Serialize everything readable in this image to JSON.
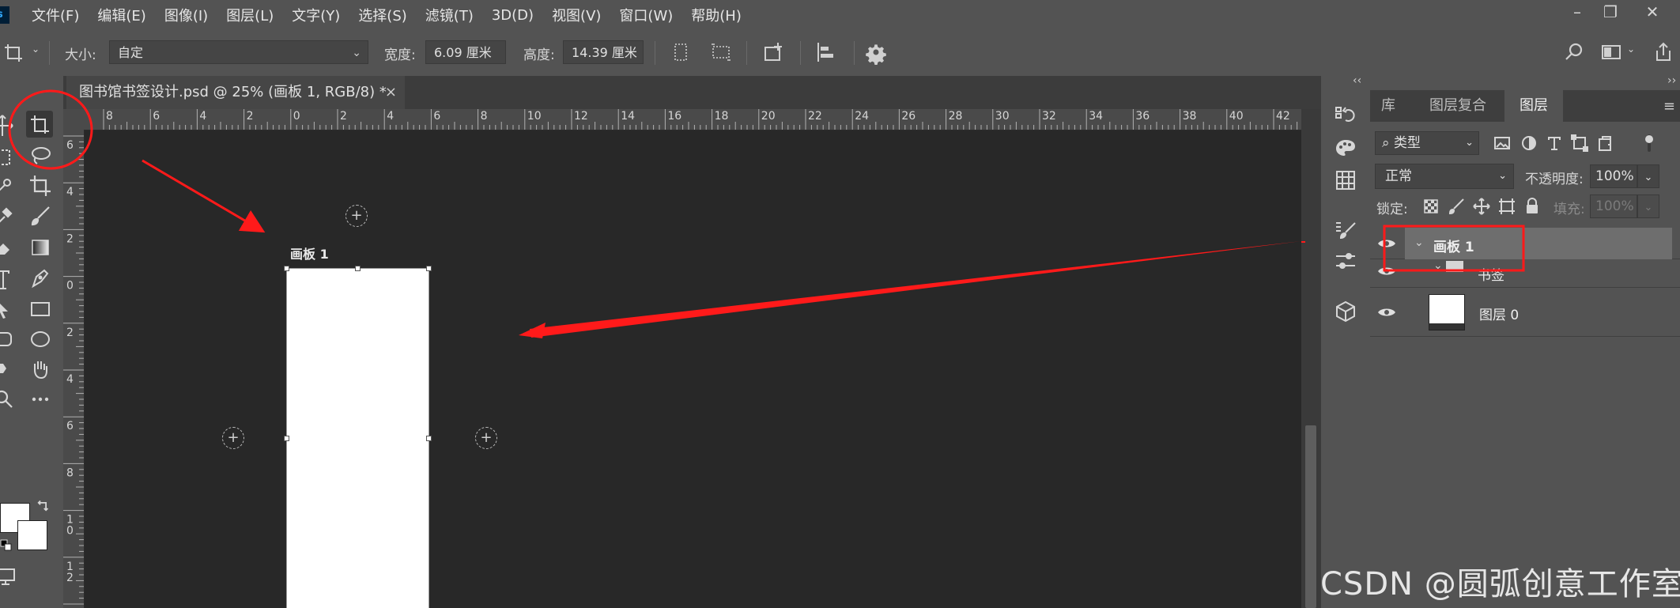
{
  "app": {
    "logo_text": "s"
  },
  "menu": {
    "items": [
      "文件(F)",
      "编辑(E)",
      "图像(I)",
      "图层(L)",
      "文字(Y)",
      "选择(S)",
      "滤镜(T)",
      "3D(D)",
      "视图(V)",
      "窗口(W)",
      "帮助(H)"
    ],
    "window_controls": {
      "minimize": "–",
      "restore": "❐",
      "close": "✕"
    }
  },
  "options": {
    "size_label": "大小:",
    "size_value": "自定",
    "width_label": "宽度:",
    "width_value": "6.09 厘米",
    "height_label": "高度:",
    "height_value": "14.39 厘米"
  },
  "document": {
    "tab_title": "图书馆书签设计.psd @ 25% (画板 1, RGB/8) *",
    "close_glyph": "×"
  },
  "rulers": {
    "h_labels": [
      "8",
      "6",
      "4",
      "2",
      "0",
      "2",
      "4",
      "6",
      "8",
      "10",
      "12",
      "14",
      "16",
      "18",
      "20",
      "22",
      "24",
      "26",
      "28",
      "30",
      "32",
      "34",
      "36",
      "38",
      "40",
      "42"
    ],
    "v_labels": [
      "6",
      "4",
      "2",
      "0",
      "2",
      "4",
      "6",
      "8",
      "10",
      "12"
    ]
  },
  "canvas": {
    "artboard_label": "画板 1"
  },
  "panel": {
    "tabs": [
      "库",
      "图层复合",
      "图层"
    ],
    "active_tab": "图层",
    "filter_label": "类型",
    "blend_mode": "正常",
    "opacity_label": "不透明度:",
    "opacity_value": "100%",
    "lock_label": "锁定:",
    "fill_label": "填充:",
    "fill_value": "100%",
    "layers": [
      {
        "name": "画板 1",
        "kind": "artboard",
        "selected": true
      },
      {
        "name": "书签",
        "kind": "group",
        "selected": false
      },
      {
        "name": "图层 0",
        "kind": "pixel",
        "selected": false
      }
    ]
  },
  "watermark": "CSDN @圆弧创意工作室",
  "colors": {
    "annotation_red": "#ff1a1a",
    "ui_bg": "#535353",
    "canvas_bg": "#282828"
  }
}
